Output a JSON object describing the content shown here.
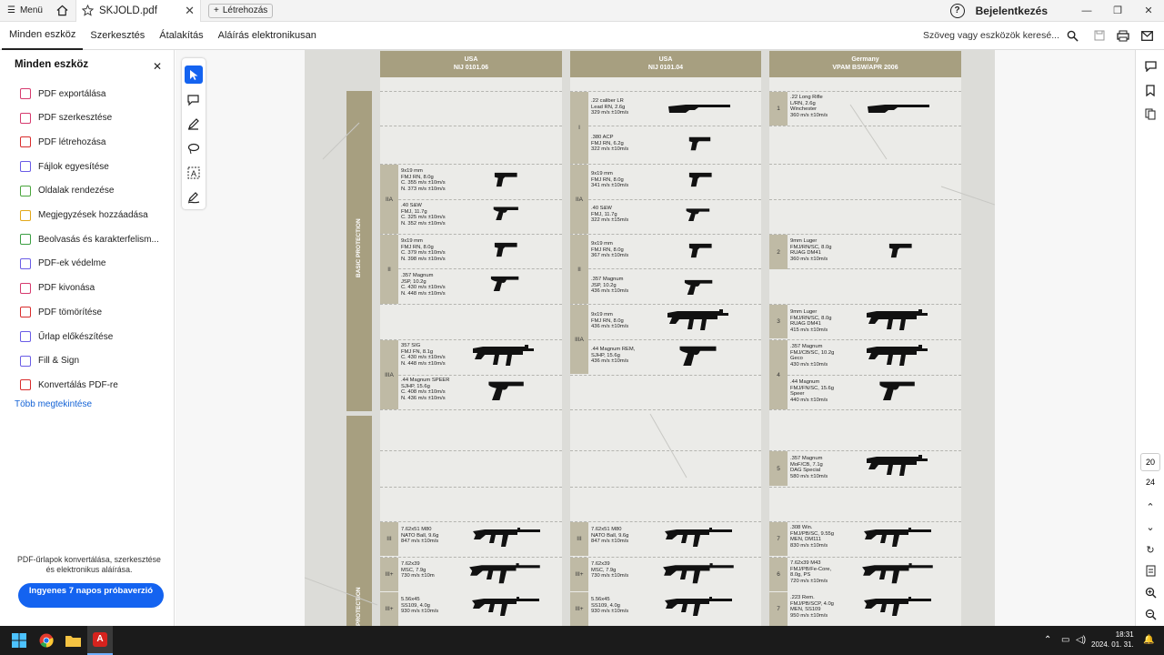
{
  "titlebar": {
    "menu": "Menü",
    "file_tab": "SKJOLD.pdf",
    "create": "Létrehozás",
    "login": "Bejelentkezés"
  },
  "toolbar": {
    "tabs": [
      "Minden eszköz",
      "Szerkesztés",
      "Átalakítás",
      "Aláírás elektronikusan"
    ],
    "search_placeholder": "Szöveg vagy eszközök keresé..."
  },
  "leftpanel": {
    "title": "Minden eszköz",
    "items": [
      {
        "label": "PDF exportálása",
        "color": "#d63a6e"
      },
      {
        "label": "PDF szerkesztése",
        "color": "#d63a6e"
      },
      {
        "label": "PDF létrehozása",
        "color": "#d92c2c"
      },
      {
        "label": "Fájlok egyesítése",
        "color": "#6a5ce6"
      },
      {
        "label": "Oldalak rendezése",
        "color": "#4aa53d"
      },
      {
        "label": "Megjegyzések hozzáadása",
        "color": "#e3a81a"
      },
      {
        "label": "Beolvasás és karakterfelism...",
        "color": "#3b9e42"
      },
      {
        "label": "PDF-ek védelme",
        "color": "#6a5ce6"
      },
      {
        "label": "PDF kivonása",
        "color": "#d63a6e"
      },
      {
        "label": "PDF tömörítése",
        "color": "#d92c2c"
      },
      {
        "label": "Űrlap előkészítése",
        "color": "#6a5ce6"
      },
      {
        "label": "Fill & Sign",
        "color": "#6a5ce6"
      },
      {
        "label": "Konvertálás PDF-re",
        "color": "#d92c2c"
      }
    ],
    "more": "Több megtekintése",
    "promo": "PDF-űrlapok konvertálása, szerkesztése és elektronikus aláírása.",
    "trial_button": "Ingyenes 7 napos próbaverzió"
  },
  "document": {
    "columns": [
      {
        "country": "USA",
        "standard": "NIJ 0101.06"
      },
      {
        "country": "USA",
        "standard": "NIJ 0101.04"
      },
      {
        "country": "Germany",
        "standard": "VPAM BSW/APR 2006"
      }
    ],
    "section_labels": [
      "BASIC PROTECTION",
      "PROTECTION"
    ],
    "col1": [
      {
        "level": "IIA",
        "text": "9x19 mm\nFMJ RN, 8.0g\nC. 355 m/s ±10m/s\nN. 373 m/s ±10m/s"
      },
      {
        "level": "",
        "text": ".40 S&W\nFMJ, 11.7g\nC. 325 m/s ±10m/s\nN. 352 m/s ±10m/s"
      },
      {
        "level": "II",
        "text": "9x19 mm\nFMJ RN, 8.0g\nC. 379 m/s ±10m/s\nN. 398 m/s ±10m/s"
      },
      {
        "level": "",
        "text": ".357 Magnum\nJSP, 10.2g\nC. 430 m/s ±10m/s\nN. 448 m/s ±10m/s"
      },
      {
        "level": "IIIA",
        "text": "357 SIG\nFMJ FN, 8.1g\nC. 430 m/s ±10m/s\nN. 448 m/s ±10m/s"
      },
      {
        "level": "",
        "text": ".44 Magnum SPEER\nSJHP, 15.6g\nC. 408 m/s ±10m/s\nN. 436 m/s ±10m/s"
      },
      {
        "level": "III",
        "text": "7.62x51 M80\nNATO Ball, 9.6g\n847 m/s ±10m/s"
      },
      {
        "level": "III+",
        "text": "7.62x39\nMSC, 7.9g\n730 m/s ±10m"
      },
      {
        "level": "III+",
        "text": "5.56x45\nSS109, 4.0g\n930 m/s ±10m/s"
      }
    ],
    "col2": [
      {
        "level": "I",
        "text": ".22 caliber LR\nLead RN, 2.6g\n329 m/s ±10m/s"
      },
      {
        "level": "",
        "text": ".380 ACP\nFMJ RN, 6.2g\n322 m/s ±10m/s"
      },
      {
        "level": "IIA",
        "text": "9x19 mm\nFMJ RN, 8.0g\n341 m/s ±10m/s"
      },
      {
        "level": "",
        "text": ".40 S&W\nFMJ, 11.7g\n322 m/s ±15m/s"
      },
      {
        "level": "II",
        "text": "9x19 mm\nFMJ RN, 8.0g\n367 m/s ±10m/s"
      },
      {
        "level": "",
        "text": ".357 Magnum\nJSP, 10.2g\n436 m/s ±10m/s"
      },
      {
        "level": "IIIA",
        "text": "9x19 mm\nFMJ RN, 8.0g\n436 m/s ±10m/s"
      },
      {
        "level": "",
        "text": ".44 Magnum REM,\nSJHP, 15.6g\n436 m/s ±10m/s"
      },
      {
        "level": "III",
        "text": "7.62x51 M80\nNATO Ball, 9.6g\n847 m/s ±10m/s"
      },
      {
        "level": "III+",
        "text": "7.62x39\nMSC, 7.9g\n730 m/s ±10m/s"
      },
      {
        "level": "III+",
        "text": "5.56x45\nSS109, 4.0g\n930 m/s ±10m/s"
      }
    ],
    "col3": [
      {
        "level": "1",
        "text": ".22 Long Rifle\nL/RN, 2.6g\nWinchester\n360 m/s ±10m/s"
      },
      {
        "level": "2",
        "text": "9mm Luger\nFMJ/RN/SC, 8.0g\nRUAG DM41\n360 m/s ±10m/s"
      },
      {
        "level": "3",
        "text": "9mm Luger\nFMJ/RN/SC, 8.0g\nRUAG DM41\n415 m/s ±10m/s"
      },
      {
        "level": "4",
        "text": ".357 Magnum\nFMJ/CB/SC, 10.2g\nGeco\n430 m/s ±10m/s"
      },
      {
        "level": "",
        "text": ".44 Magnum\nFMJ/FN/SC, 15.6g\nSpeer\n440 m/s ±10m/s"
      },
      {
        "level": "5",
        "text": ".357 Magnum\nMoF/CB, 7.1g\nDAG Special\n580 m/s ±10m/s"
      },
      {
        "level": "7",
        "text": ".308 Win.\nFMJ/PB/SC, 9.55g\nMEN, DM111\n830 m/s ±10m/s"
      },
      {
        "level": "6",
        "text": "7.62x39 M43\nFMJ/PB/Fe-Core,\n8.0g, PS\n720 m/s ±10m/s"
      },
      {
        "level": "7",
        "text": ".223 Rem.\nFMJ/PB/SCP, 4.0g\nMEN, SS109\n950 m/s ±10m/s"
      }
    ]
  },
  "rightrail": {
    "page": "20",
    "total": "24"
  },
  "taskbar": {
    "time": "18:31",
    "date": "2024. 01. 31."
  }
}
